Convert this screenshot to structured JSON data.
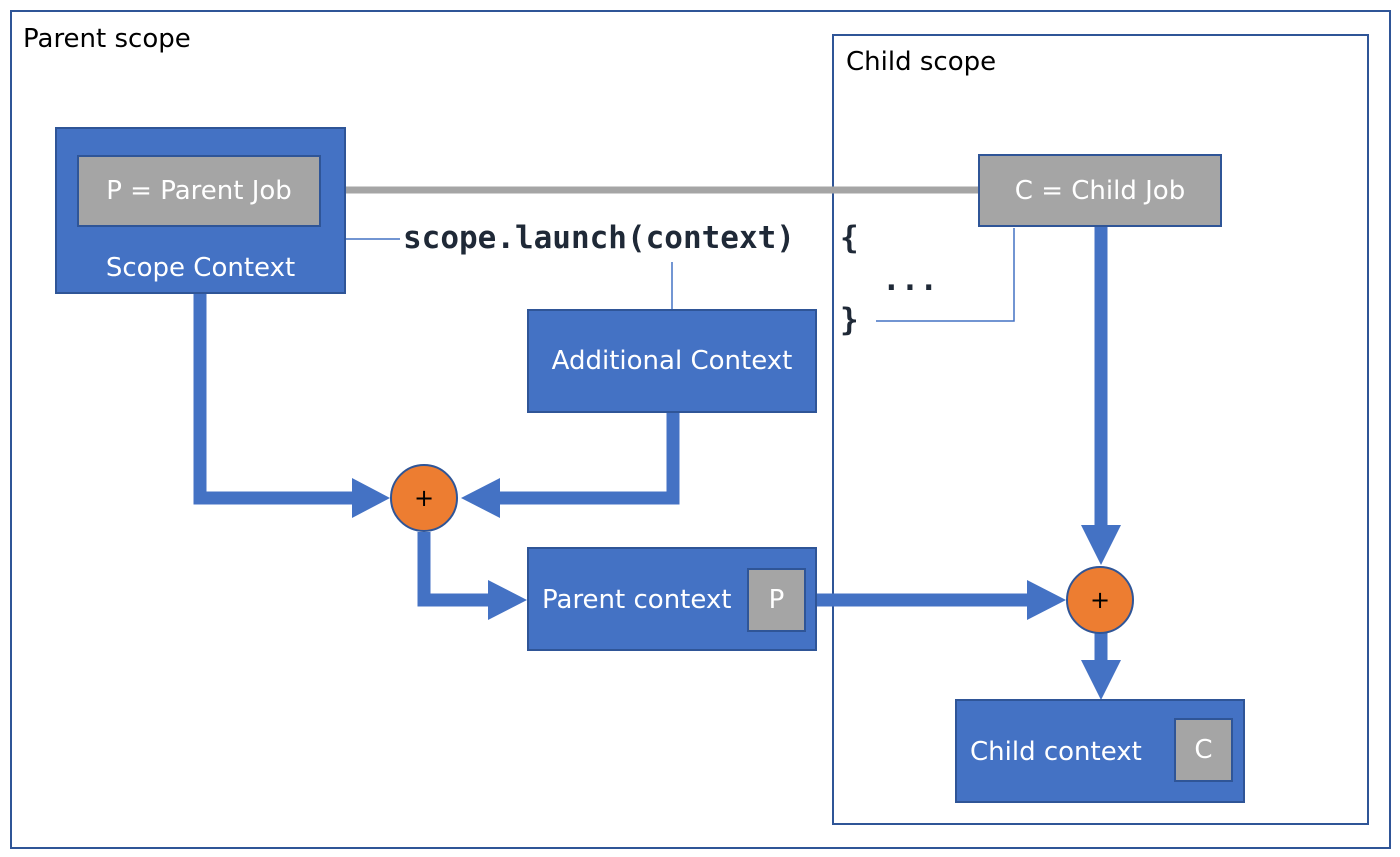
{
  "diagram": {
    "parent_scope": {
      "label": "Parent scope"
    },
    "child_scope": {
      "label": "Child scope"
    },
    "scope_context": {
      "label": "Scope Context",
      "job_label": "P = Parent Job"
    },
    "child_job": {
      "label": "C = Child Job"
    },
    "code": {
      "launch_call": "scope.launch(context)",
      "open_brace": "{",
      "ellipsis": "...",
      "close_brace": "}"
    },
    "additional_context": {
      "label": "Additional Context"
    },
    "combine_operator_1": {
      "symbol": "+"
    },
    "combine_operator_2": {
      "symbol": "+"
    },
    "parent_context": {
      "label": "Parent context",
      "job_badge": "P"
    },
    "child_context": {
      "label": "Child context",
      "job_badge": "C"
    },
    "colors": {
      "context_blue": "#4472c4",
      "border_blue": "#2f5597",
      "job_gray": "#a5a5a5",
      "operator_orange": "#ed7d31"
    }
  }
}
